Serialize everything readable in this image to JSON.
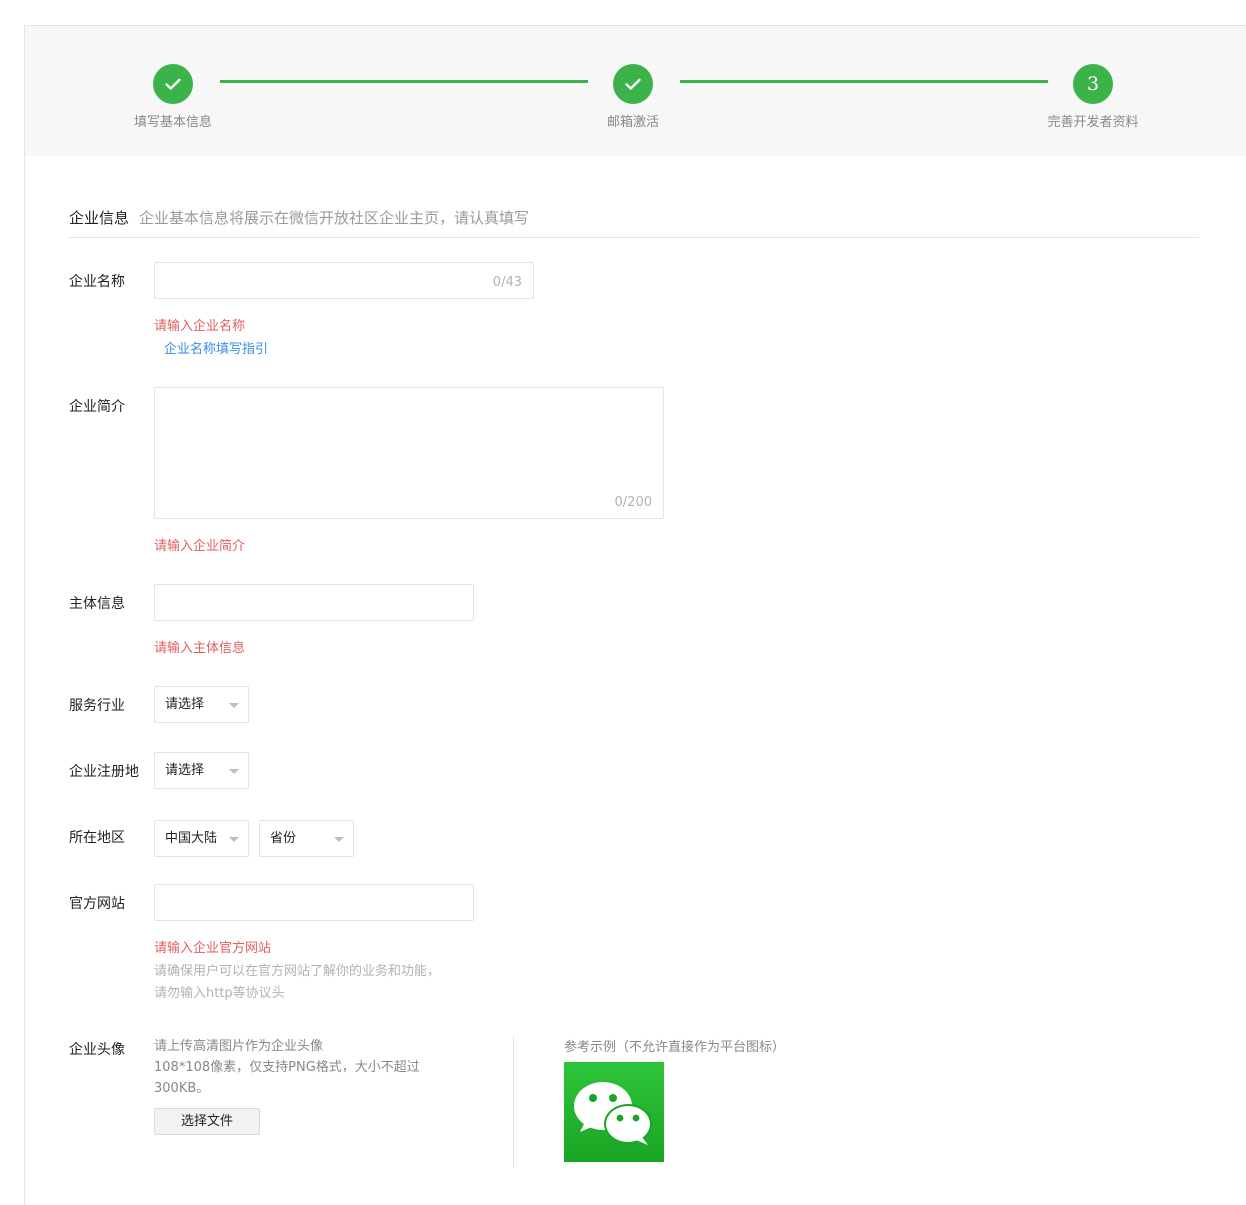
{
  "steps": [
    {
      "label": "填写基本信息",
      "state": "done",
      "icon": "check-icon"
    },
    {
      "label": "邮箱激活",
      "state": "done",
      "icon": "check-icon"
    },
    {
      "label": "完善开发者资料",
      "state": "current",
      "number": "3"
    }
  ],
  "section": {
    "title": "企业信息",
    "desc": "企业基本信息将展示在微信开放社区企业主页，请认真填写"
  },
  "fields": {
    "company_name": {
      "label": "企业名称",
      "value": "",
      "counter": "0/43",
      "error": "请输入企业名称",
      "guide_link": "企业名称填写指引"
    },
    "company_intro": {
      "label": "企业简介",
      "value": "",
      "counter": "0/200",
      "error": "请输入企业简介"
    },
    "entity_info": {
      "label": "主体信息",
      "value": "",
      "error": "请输入主体信息"
    },
    "industry": {
      "label": "服务行业",
      "selected": "请选择"
    },
    "reg_place": {
      "label": "企业注册地",
      "selected": "请选择"
    },
    "region": {
      "label": "所在地区",
      "country": "中国大陆",
      "province": "省份"
    },
    "website": {
      "label": "官方网站",
      "value": "",
      "error": "请输入企业官方网站",
      "hint_line1": "请确保用户可以在官方网站了解你的业务和功能，",
      "hint_line2": "请勿输入http等协议头"
    },
    "avatar": {
      "label": "企业头像",
      "hint_line1": "请上传高清图片作为企业头像",
      "hint_line2": "108*108像素，仅支持PNG格式，大小不超过",
      "hint_line3": "300KB。",
      "button": "选择文件",
      "ref_label": "参考示例（不允许直接作为平台图标）",
      "ref_icon": "wechat-logo-icon"
    }
  },
  "colors": {
    "accent": "#3cb34a",
    "error": "#e15f5f",
    "link": "#3a8ee6",
    "hint": "#b2b2b2"
  }
}
